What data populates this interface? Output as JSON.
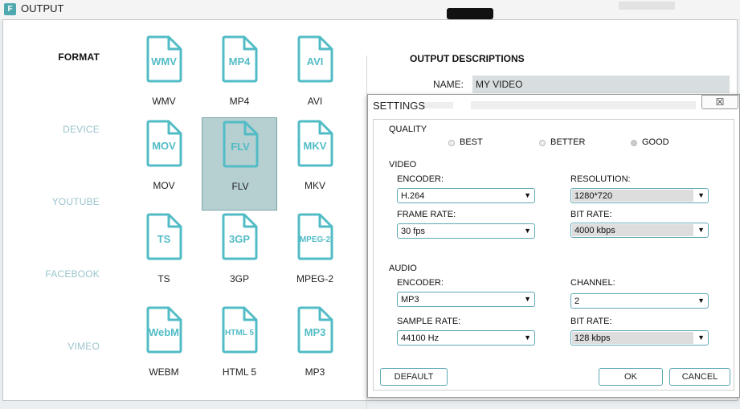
{
  "window": {
    "title": "OUTPUT",
    "app_icon": "F"
  },
  "categories": [
    "FORMAT",
    "DEVICE",
    "YOUTUBE",
    "FACEBOOK",
    "VIMEO"
  ],
  "formats": [
    {
      "badge": "WMV",
      "label": "WMV"
    },
    {
      "badge": "MP4",
      "label": "MP4"
    },
    {
      "badge": "AVI",
      "label": "AVI"
    },
    {
      "badge": "MOV",
      "label": "MOV"
    },
    {
      "badge": "FLV",
      "label": "FLV"
    },
    {
      "badge": "MKV",
      "label": "MKV"
    },
    {
      "badge": "TS",
      "label": "TS"
    },
    {
      "badge": "3GP",
      "label": "3GP"
    },
    {
      "badge": "MPEG-2",
      "label": "MPEG-2"
    },
    {
      "badge": "WebM",
      "label": "WEBM"
    },
    {
      "badge": "HTML 5",
      "label": "HTML 5"
    },
    {
      "badge": "MP3",
      "label": "MP3"
    }
  ],
  "selected_format": "FLV",
  "output": {
    "heading": "OUTPUT DESCRIPTIONS",
    "name_label": "NAME:",
    "name_value": "MY VIDEO"
  },
  "settings": {
    "title": "SETTINGS",
    "close_glyph": "☒",
    "quality": {
      "label": "QUALITY",
      "options": [
        "BEST",
        "BETTER",
        "GOOD"
      ],
      "selected": "GOOD"
    },
    "video": {
      "label": "VIDEO",
      "encoder_label": "ENCODER:",
      "encoder": "H.264",
      "resolution_label": "RESOLUTION:",
      "resolution": "1280*720",
      "frame_rate_label": "FRAME RATE:",
      "frame_rate": "30 fps",
      "bit_rate_label": "BIT RATE:",
      "bit_rate": "4000 kbps"
    },
    "audio": {
      "label": "AUDIO",
      "encoder_label": "ENCODER:",
      "encoder": "MP3",
      "channel_label": "CHANNEL:",
      "channel": "2",
      "sample_rate_label": "SAMPLE RATE:",
      "sample_rate": "44100 Hz",
      "bit_rate_label": "BIT RATE:",
      "bit_rate": "128 kbps"
    },
    "buttons": {
      "default": "DEFAULT",
      "ok": "OK",
      "cancel": "CANCEL"
    }
  },
  "icons": {
    "dropdown": "chevron-down-icon",
    "file": "file-icon",
    "close": "close-icon"
  },
  "colors": {
    "accent": "#52bcc6",
    "selected_tile": "#b6cfd1",
    "category_inactive": "#9ac4cc"
  }
}
